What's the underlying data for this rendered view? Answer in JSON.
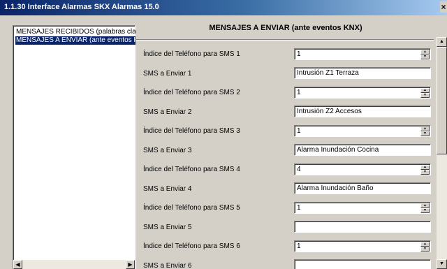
{
  "window": {
    "title": "1.1.30 Interface Alarmas SKX Alarmas 15.0",
    "close_glyph": "×"
  },
  "sidebar": {
    "items": [
      {
        "label": "MENSAJES RECIBIDOS (palabras clave)",
        "selected": false
      },
      {
        "label": "MENSAJES A ENVIAR (ante eventos KNX)",
        "selected": true
      }
    ]
  },
  "main": {
    "header": "MENSAJES A ENVIAR (ante eventos KNX)",
    "rows": [
      {
        "label": "Índice del Teléfono para SMS 1",
        "kind": "spin",
        "value": "1"
      },
      {
        "label": "SMS a Enviar 1",
        "kind": "text",
        "value": "Intrusión Z1 Terraza"
      },
      {
        "label": "Índice del Teléfono para SMS 2",
        "kind": "spin",
        "value": "1"
      },
      {
        "label": "SMS a Enviar 2",
        "kind": "text",
        "value": "Intrusión Z2 Accesos"
      },
      {
        "label": "Índice del Teléfono para SMS 3",
        "kind": "spin",
        "value": "1"
      },
      {
        "label": "SMS a Enviar 3",
        "kind": "text",
        "value": "Alarma Inundación Cocina"
      },
      {
        "label": "Índice del Teléfono para SMS 4",
        "kind": "spin",
        "value": "4"
      },
      {
        "label": "SMS a Enviar 4",
        "kind": "text",
        "value": "Alarma Inundación Baño"
      },
      {
        "label": "Índice del Teléfono para SMS 5",
        "kind": "spin",
        "value": "1"
      },
      {
        "label": "SMS a Enviar 5",
        "kind": "text",
        "value": ""
      },
      {
        "label": "Índice del Teléfono para SMS 6",
        "kind": "spin",
        "value": "1"
      },
      {
        "label": "SMS a Enviar 6",
        "kind": "text",
        "value": ""
      }
    ]
  },
  "icons": {
    "scroll_up": "▲",
    "scroll_down": "▼",
    "scroll_left": "◀",
    "scroll_right": "▶",
    "spin_up": "▲",
    "spin_down": "▼"
  },
  "colors": {
    "title_start": "#0a246a",
    "title_end": "#a6caf0",
    "face": "#d4d0c8",
    "selection": "#0a246a"
  }
}
